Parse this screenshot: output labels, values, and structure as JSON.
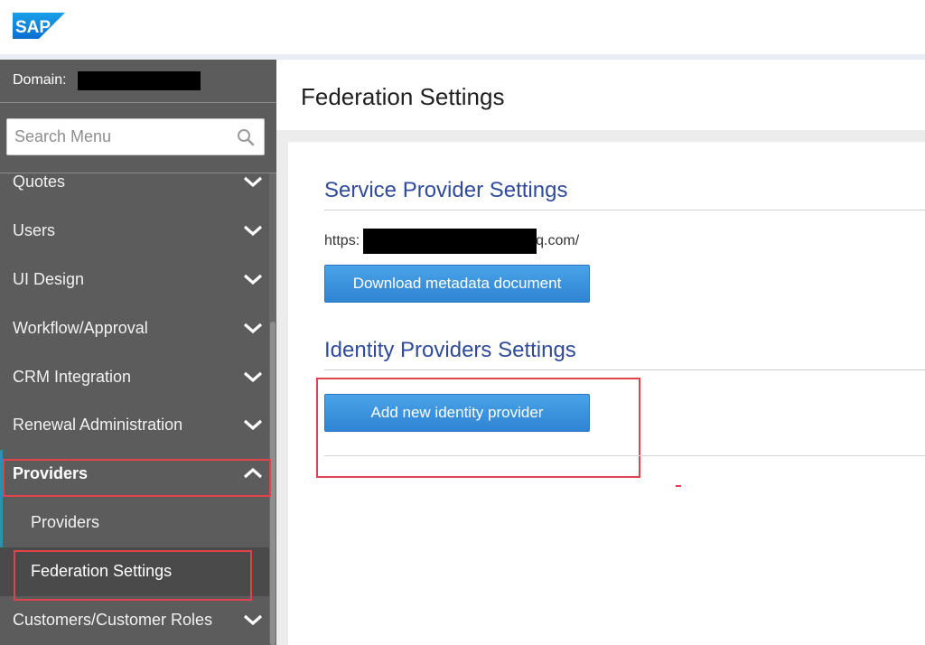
{
  "app": {
    "logo_text": "SAP"
  },
  "sidebar": {
    "domain_label": "Domain:",
    "search": {
      "placeholder": "Search Menu"
    },
    "items": [
      {
        "label": "Quotes",
        "expanded": false
      },
      {
        "label": "Users",
        "expanded": false
      },
      {
        "label": "UI Design",
        "expanded": false
      },
      {
        "label": "Workflow/Approval",
        "expanded": false
      },
      {
        "label": "CRM Integration",
        "expanded": false
      },
      {
        "label": "Renewal Administration",
        "expanded": false
      },
      {
        "label": "Providers",
        "expanded": true,
        "children": [
          {
            "label": "Providers"
          },
          {
            "label": "Federation Settings",
            "active": true
          }
        ]
      },
      {
        "label": "Customers/Customer Roles",
        "expanded": false
      }
    ]
  },
  "main": {
    "title": "Federation Settings",
    "sp_section": {
      "title": "Service Provider Settings",
      "url_prefix": "https:",
      "url_suffix": "q.com/",
      "download_button": "Download metadata document"
    },
    "idp_section": {
      "title": "Identity Providers Settings",
      "add_button": "Add new identity provider"
    }
  },
  "colors": {
    "sidebar_bg": "#5c5c5c",
    "accent_blue": "#2f84d3",
    "section_title": "#2f4b9a",
    "highlight_red": "#e0434b"
  }
}
